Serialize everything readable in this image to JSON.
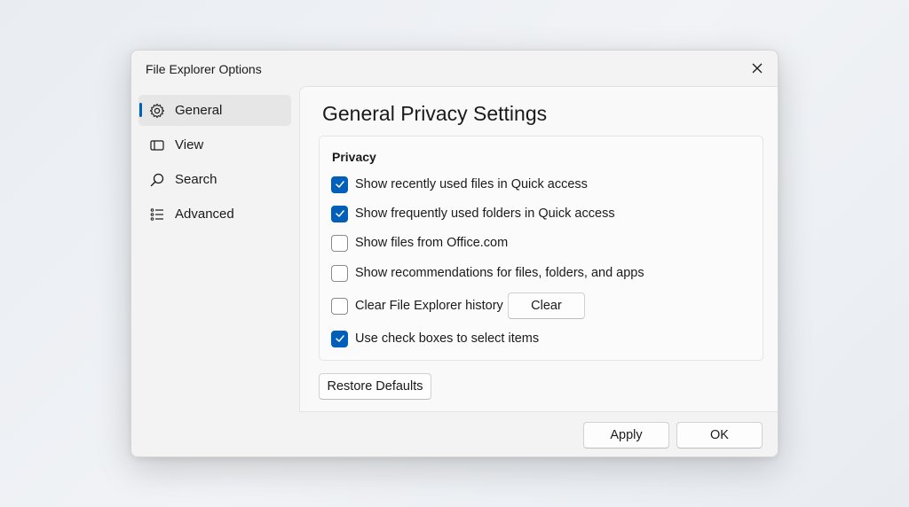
{
  "window": {
    "title": "File Explorer Options"
  },
  "sidebar": {
    "items": [
      {
        "label": "General",
        "icon": "gear-icon",
        "active": true
      },
      {
        "label": "View",
        "icon": "view-icon",
        "active": false
      },
      {
        "label": "Search",
        "icon": "search-icon",
        "active": false
      },
      {
        "label": "Advanced",
        "icon": "list-icon",
        "active": false
      }
    ]
  },
  "main": {
    "title": "General Privacy Settings",
    "section": {
      "header": "Privacy",
      "options": [
        {
          "label": "Show recently used files in Quick access",
          "checked": true
        },
        {
          "label": "Show frequently used folders in Quick access",
          "checked": true
        },
        {
          "label": "Show files from Office.com",
          "checked": false
        },
        {
          "label": "Show recommendations for files, folders, and apps",
          "checked": false
        },
        {
          "label": "Clear File Explorer history",
          "checked": false
        },
        {
          "label": "Use check boxes to select items",
          "checked": true
        }
      ],
      "clear_button": "Clear"
    },
    "restore_button": "Restore Defaults"
  },
  "footer": {
    "apply_button": "Apply",
    "ok_button": "OK"
  },
  "colors": {
    "accent": "#005fb8",
    "background": "#f3f3f3"
  }
}
